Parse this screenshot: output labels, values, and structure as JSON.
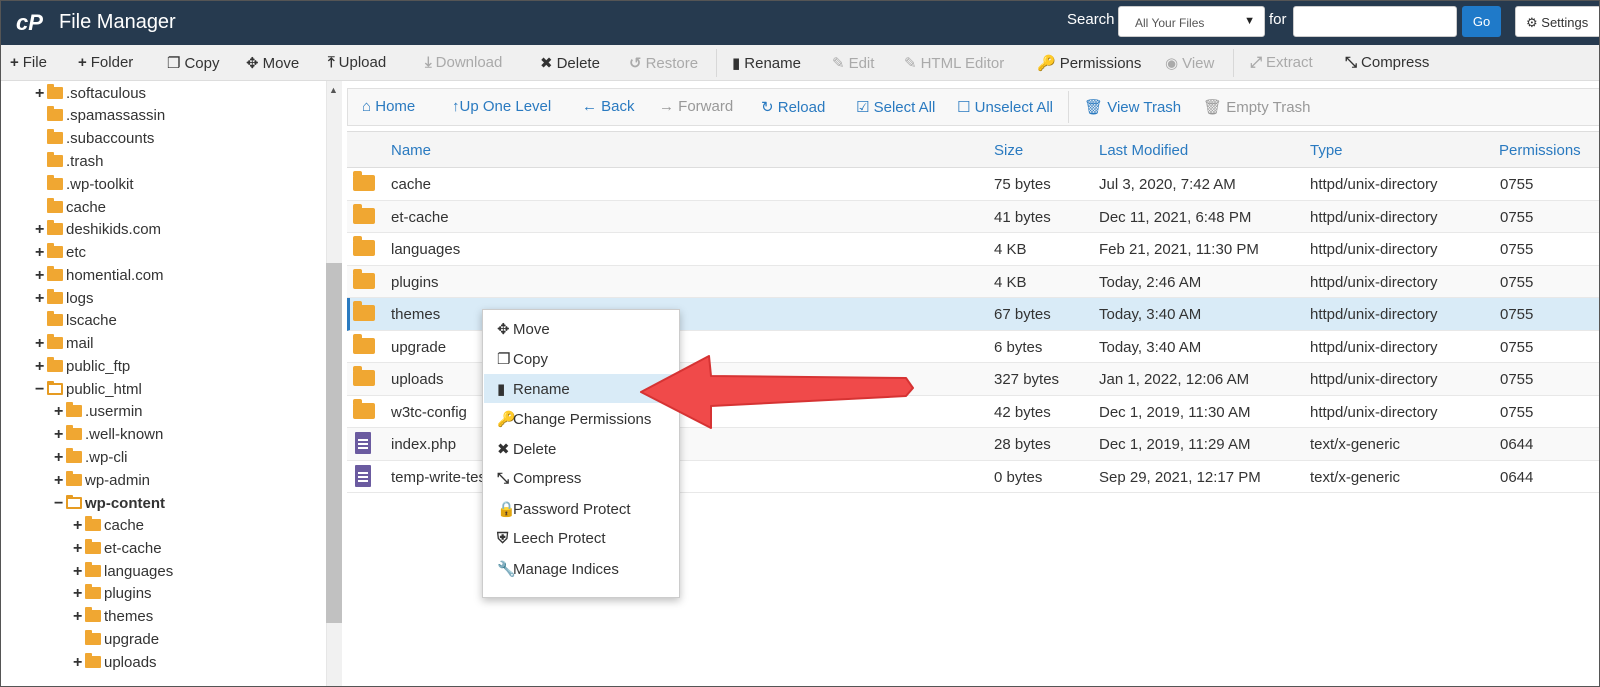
{
  "header": {
    "app_title": "File Manager",
    "search_label": "Search",
    "search_scope": "All Your Files",
    "for_label": "for",
    "search_value": "",
    "go_label": "Go",
    "settings_label": "Settings"
  },
  "toolbar": {
    "file": "File",
    "folder": "Folder",
    "copy": "Copy",
    "move": "Move",
    "upload": "Upload",
    "download": "Download",
    "delete": "Delete",
    "restore": "Restore",
    "rename": "Rename",
    "edit": "Edit",
    "html_editor": "HTML Editor",
    "permissions": "Permissions",
    "view": "View",
    "extract": "Extract",
    "compress": "Compress"
  },
  "tree": [
    {
      "label": ".softaculous",
      "toggle": "+"
    },
    {
      "label": ".spamassassin",
      "toggle": ""
    },
    {
      "label": ".subaccounts",
      "toggle": ""
    },
    {
      "label": ".trash",
      "toggle": ""
    },
    {
      "label": ".wp-toolkit",
      "toggle": ""
    },
    {
      "label": "cache",
      "toggle": ""
    },
    {
      "label": "deshikids.com",
      "toggle": "+"
    },
    {
      "label": "etc",
      "toggle": "+"
    },
    {
      "label": "homential.com",
      "toggle": "+"
    },
    {
      "label": "logs",
      "toggle": "+"
    },
    {
      "label": "lscache",
      "toggle": ""
    },
    {
      "label": "mail",
      "toggle": "+"
    },
    {
      "label": "public_ftp",
      "toggle": "+"
    },
    {
      "label": "public_html",
      "toggle": "−"
    },
    {
      "label": ".usermin",
      "toggle": "+"
    },
    {
      "label": ".well-known",
      "toggle": "+"
    },
    {
      "label": ".wp-cli",
      "toggle": "+"
    },
    {
      "label": "wp-admin",
      "toggle": "+"
    },
    {
      "label": "wp-content",
      "toggle": "−"
    },
    {
      "label": "cache",
      "toggle": "+"
    },
    {
      "label": "et-cache",
      "toggle": "+"
    },
    {
      "label": "languages",
      "toggle": "+"
    },
    {
      "label": "plugins",
      "toggle": "+"
    },
    {
      "label": "themes",
      "toggle": "+"
    },
    {
      "label": "upgrade",
      "toggle": ""
    },
    {
      "label": "uploads",
      "toggle": "+"
    }
  ],
  "nav": {
    "home": "Home",
    "up": "Up One Level",
    "back": "Back",
    "forward": "Forward",
    "reload": "Reload",
    "select_all": "Select All",
    "unselect_all": "Unselect All",
    "view_trash": "View Trash",
    "empty_trash": "Empty Trash"
  },
  "columns": {
    "name": "Name",
    "size": "Size",
    "modified": "Last Modified",
    "type": "Type",
    "perms": "Permissions"
  },
  "files": [
    {
      "name": "cache",
      "size": "75 bytes",
      "modified": "Jul 3, 2020, 7:42 AM",
      "type": "httpd/unix-directory",
      "perms": "0755"
    },
    {
      "name": "et-cache",
      "size": "41 bytes",
      "modified": "Dec 11, 2021, 6:48 PM",
      "type": "httpd/unix-directory",
      "perms": "0755"
    },
    {
      "name": "languages",
      "size": "4 KB",
      "modified": "Feb 21, 2021, 11:30 PM",
      "type": "httpd/unix-directory",
      "perms": "0755"
    },
    {
      "name": "plugins",
      "size": "4 KB",
      "modified": "Today, 2:46 AM",
      "type": "httpd/unix-directory",
      "perms": "0755"
    },
    {
      "name": "themes",
      "size": "67 bytes",
      "modified": "Today, 3:40 AM",
      "type": "httpd/unix-directory",
      "perms": "0755"
    },
    {
      "name": "upgrade",
      "size": "6 bytes",
      "modified": "Today, 3:40 AM",
      "type": "httpd/unix-directory",
      "perms": "0755"
    },
    {
      "name": "uploads",
      "size": "327 bytes",
      "modified": "Jan 1, 2022, 12:06 AM",
      "type": "httpd/unix-directory",
      "perms": "0755"
    },
    {
      "name": "w3tc-config",
      "size": "42 bytes",
      "modified": "Dec 1, 2019, 11:30 AM",
      "type": "httpd/unix-directory",
      "perms": "0755"
    },
    {
      "name": "index.php",
      "size": "28 bytes",
      "modified": "Dec 1, 2019, 11:29 AM",
      "type": "text/x-generic",
      "perms": "0644"
    },
    {
      "name": "temp-write-tes",
      "size": "0 bytes",
      "modified": "Sep 29, 2021, 12:17 PM",
      "type": "text/x-generic",
      "perms": "0644"
    }
  ],
  "context_menu": {
    "move": "Move",
    "copy": "Copy",
    "rename": "Rename",
    "change_permissions": "Change Permissions",
    "delete": "Delete",
    "compress": "Compress",
    "password_protect": "Password Protect",
    "leech_protect": "Leech Protect",
    "manage_indices": "Manage Indices"
  },
  "colors": {
    "header_bg": "#263a4f",
    "link": "#2a7ac0",
    "go_button": "#1f7ac9",
    "folder": "#f0a732",
    "arrow": "#f04a4a",
    "selected_row": "#d9ebf7"
  }
}
